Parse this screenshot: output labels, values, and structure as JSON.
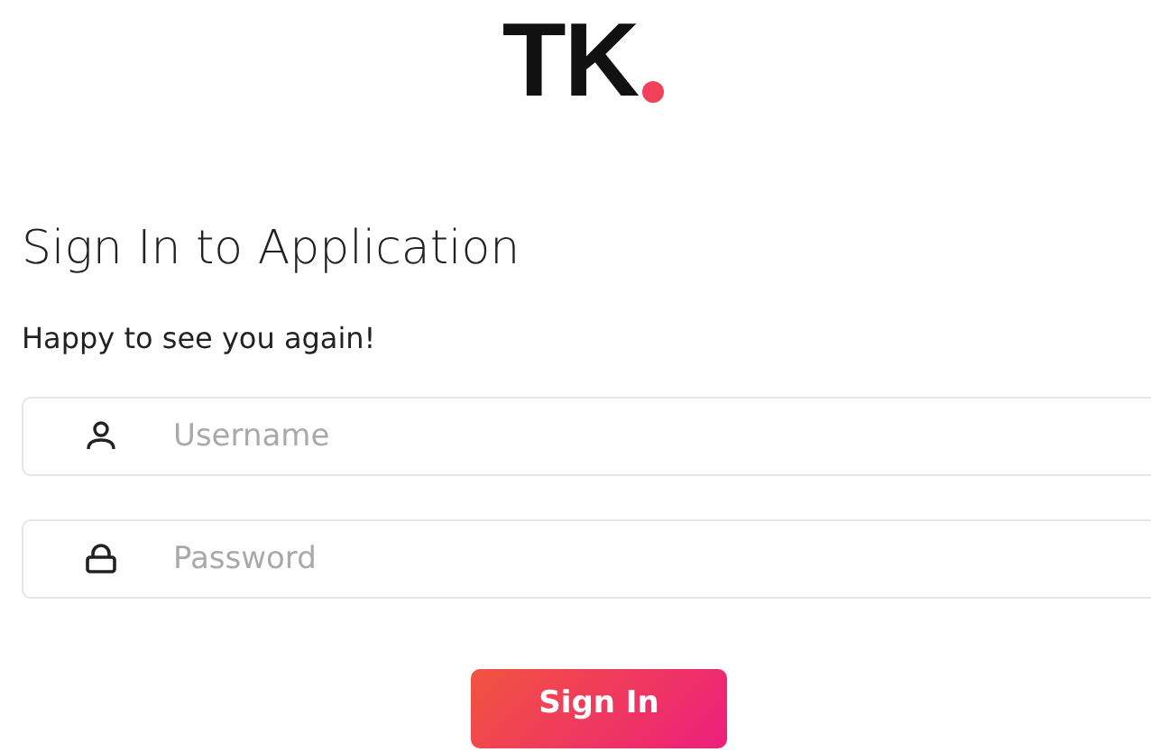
{
  "logo": {
    "text": "TK"
  },
  "title": "Sign In to Application",
  "subtitle": "Happy to see you again!",
  "fields": [
    {
      "kind": "user",
      "placeholder": "Username"
    },
    {
      "kind": "password",
      "placeholder": "Password"
    }
  ],
  "button": {
    "label": "Sign In"
  }
}
